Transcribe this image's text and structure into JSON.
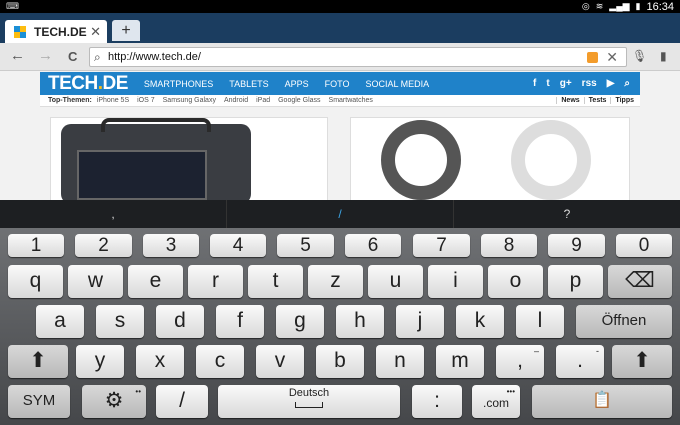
{
  "status_bar": {
    "left_glyph": "⌨",
    "time": "16:34"
  },
  "tab": {
    "title": "TECH.DE",
    "close_glyph": "✕",
    "new_tab_glyph": "+"
  },
  "toolbar": {
    "back_glyph": "←",
    "forward_glyph": "→",
    "reload_glyph": "C",
    "url": "http://www.tech.de/",
    "clear_glyph": "✕",
    "mic_glyph": "🎙",
    "bookmark_glyph": "▮"
  },
  "site": {
    "logo_main": "TECH",
    "logo_dot": ".",
    "logo_tld": "DE",
    "menu": [
      "SMARTPHONES",
      "TABLETS",
      "APPS",
      "FOTO",
      "SOCIAL MEDIA"
    ],
    "social": [
      "f",
      "t",
      "g+",
      "rss",
      "▶",
      "⌕"
    ],
    "topics_label": "Top-Themen:",
    "topics": [
      "iPhone 5S",
      "iOS 7",
      "Samsung Galaxy",
      "Android",
      "iPad",
      "Google Glass",
      "Smartwatches"
    ],
    "topics_right": [
      "News",
      "Tests",
      "Tipps"
    ]
  },
  "suggestions": [
    ",",
    "/",
    "?"
  ],
  "keyboard": {
    "numbers": [
      "1",
      "2",
      "3",
      "4",
      "5",
      "6",
      "7",
      "8",
      "9",
      "0"
    ],
    "row1": [
      "q",
      "w",
      "e",
      "r",
      "t",
      "z",
      "u",
      "i",
      "o",
      "p"
    ],
    "row2": [
      "a",
      "s",
      "d",
      "f",
      "g",
      "h",
      "j",
      "k",
      "l"
    ],
    "row3": [
      "y",
      "x",
      "c",
      "v",
      "b",
      "n",
      "m"
    ],
    "comma": ",",
    "comma_sub": "–",
    "period": ".",
    "period_sub": "-",
    "backspace_glyph": "⌫",
    "enter_label": "Öffnen",
    "shift_glyph": "⬆",
    "sym_label": "SYM",
    "settings_glyph": "⚙",
    "slash": "/",
    "space_label": "Deutsch",
    "colon": ":",
    "dotcom": ".com",
    "clipboard_glyph": "📋"
  }
}
